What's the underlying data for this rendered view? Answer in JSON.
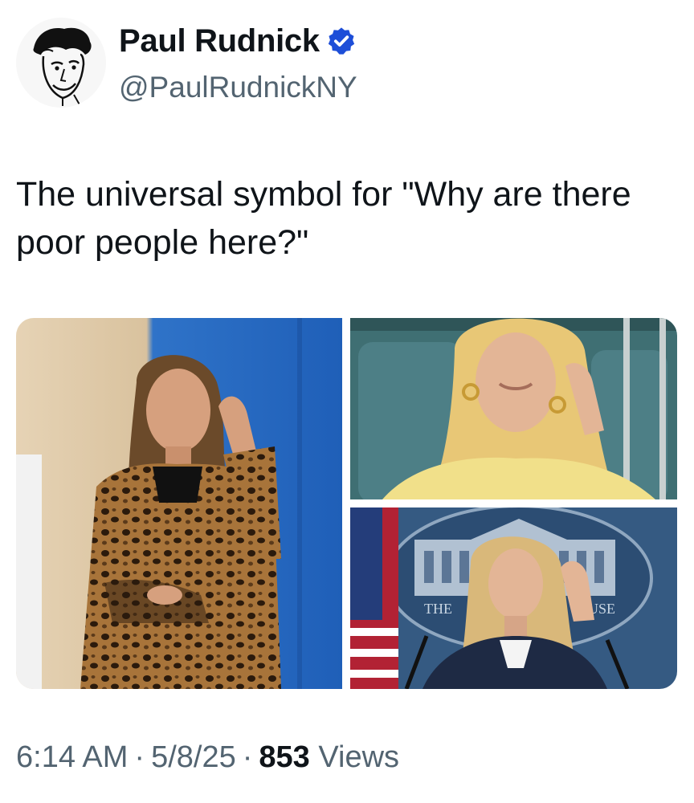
{
  "author": {
    "display_name": "Paul Rudnick",
    "handle": "@PaulRudnickNY",
    "verified_color": "#1d4ed8",
    "avatar_icon": "caricature-avatar"
  },
  "tweet": {
    "text": "The universal symbol for \"Why are there poor people here?\""
  },
  "media": {
    "photo_count": 3,
    "photo_3_caption_left": "THE",
    "photo_3_caption_right": "USE"
  },
  "meta": {
    "time": "6:14 AM",
    "date": "5/8/25",
    "view_count": "853",
    "views_label": "Views",
    "separator": "·"
  }
}
